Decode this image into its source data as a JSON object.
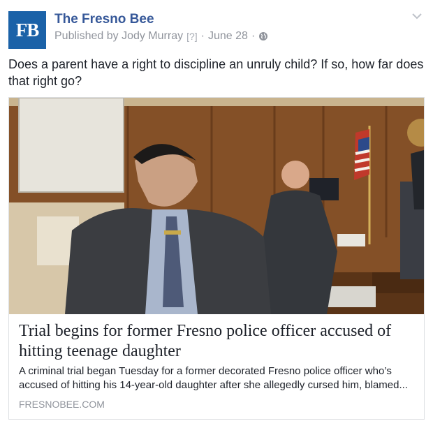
{
  "post": {
    "avatar_text": "FB",
    "page_name": "The Fresno Bee",
    "published_by": "Published by Jody Murray",
    "help_mark": "[?]",
    "separator": "·",
    "date": "June 28",
    "message": "Does a parent have a right to discipline an unruly child? If so, how far does that right go?",
    "icons": [
      "globe-icon",
      "chevron-down-icon"
    ]
  },
  "link": {
    "headline": "Trial begins for former Fresno police officer accused of hitting teenage daughter",
    "description": "A criminal trial began Tuesday for a former decorated Fresno police officer who’s accused of hitting his 14-year-old daughter after she allegedly cursed him, blamed...",
    "domain": "FRESNOBEE.COM"
  },
  "colors": {
    "brand_blue": "#365899",
    "avatar_blue": "#1b62a8",
    "muted_text": "#90949c",
    "border": "#dddfe2"
  }
}
